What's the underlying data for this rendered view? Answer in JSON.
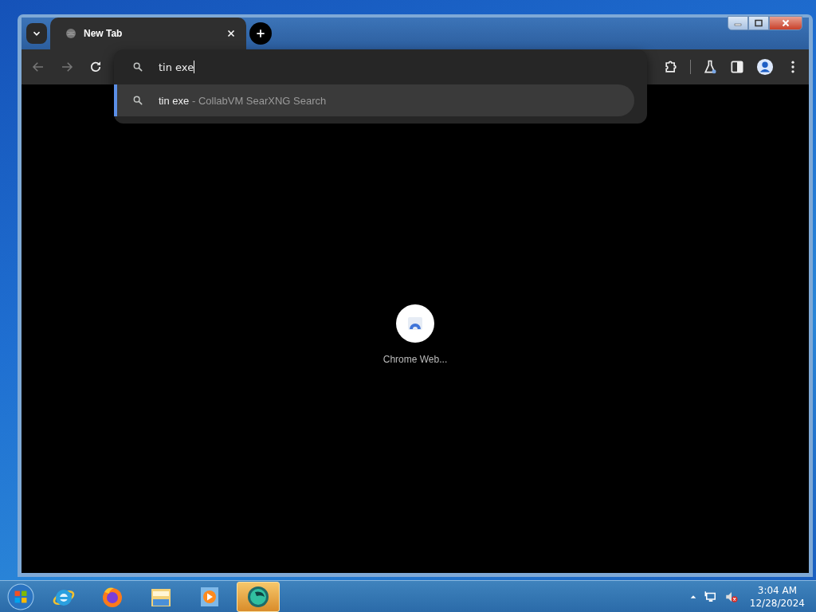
{
  "browser": {
    "tabs": [
      {
        "title": "New Tab",
        "selected": true
      }
    ],
    "omnibox": {
      "value": "tin exe",
      "suggestions": [
        {
          "query": "tin exe",
          "description": "- CollabVM SearXNG Search",
          "selected": true
        }
      ]
    },
    "new_tab_page": {
      "shortcuts": [
        {
          "title": "Chrome Web..."
        }
      ]
    }
  },
  "taskbar": {
    "apps": [
      {
        "kind": "ie",
        "selected": false
      },
      {
        "kind": "firefox",
        "selected": false
      },
      {
        "kind": "explorer",
        "selected": false
      },
      {
        "kind": "media",
        "selected": false
      },
      {
        "kind": "vm",
        "selected": true
      }
    ],
    "clock": {
      "time": "3:04 AM",
      "date": "12/28/2024"
    }
  }
}
